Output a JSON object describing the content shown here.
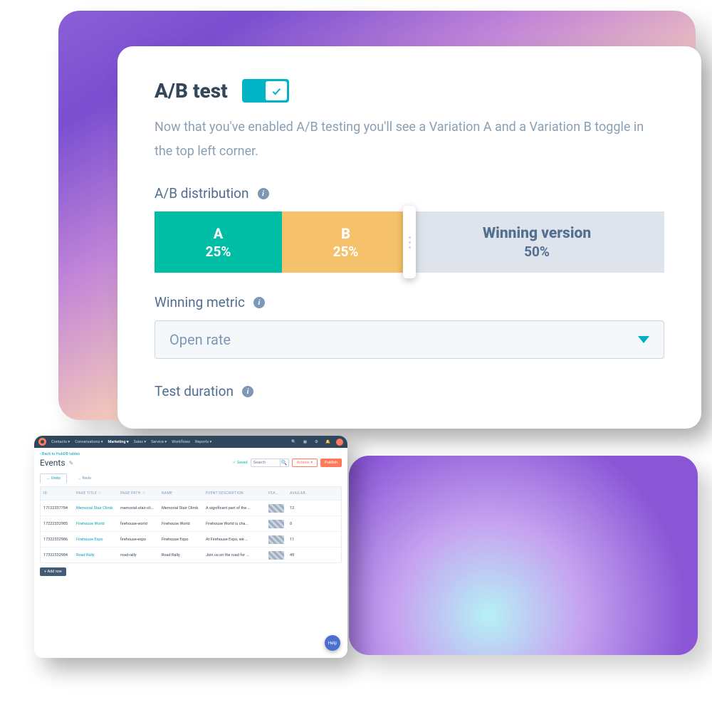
{
  "ab": {
    "title": "A/B test",
    "toggle_on": true,
    "description": "Now that you've enabled A/B testing you'll see a Variation A and a Variation B toggle in the top left corner.",
    "distribution_label": "A/B distribution",
    "segments": {
      "a": {
        "label": "A",
        "pct": "25%"
      },
      "b": {
        "label": "B",
        "pct": "25%"
      },
      "win": {
        "label": "Winning version",
        "pct": "50%"
      }
    },
    "winning_metric_label": "Winning metric",
    "winning_metric_value": "Open rate",
    "test_duration_label": "Test duration"
  },
  "events": {
    "breadcrumb": "‹ Back to HubDB tables",
    "title": "Events",
    "saved": "✓  Saved",
    "search_placeholder": "Search",
    "actions_label": "Actions ▾",
    "publish_label": "Publish",
    "tabs": {
      "undo": "Undo",
      "redo": "Redo"
    },
    "addrow": "+ Add row",
    "help": "Help",
    "topnav": {
      "items": [
        "Contacts ▾",
        "Conversations ▾",
        "Marketing ▾",
        "Sales ▾",
        "Service ▾",
        "Workflows",
        "Reports ▾"
      ],
      "active_index": 2
    },
    "columns": [
      "ID",
      "PAGE TITLE",
      "PAGE PATH",
      "NAME",
      "EVENT DESCRIPTION",
      "FEA...",
      "AVAILAB..."
    ],
    "rows": [
      {
        "id": "17122337784",
        "page_title": "Memorial Stair Climb",
        "page_path": "memorial-stair-cli...",
        "name": "Memorial Stair Climb",
        "desc": "A significant part of the ...",
        "avail": "12"
      },
      {
        "id": "17222332985",
        "page_title": "Firehouse World",
        "page_path": "firehouse-world",
        "name": "Firehouse World",
        "desc": "Firehouse World is cha...",
        "avail": "0"
      },
      {
        "id": "17322332986",
        "page_title": "Firehouse Expo",
        "page_path": "firehouse-expo",
        "name": "Firehouse Expo",
        "desc": "At Firehouse Expo, we ...",
        "avail": "11"
      },
      {
        "id": "17322332984",
        "page_title": "Road Rally",
        "page_path": "road-rally",
        "name": "Road Rally",
        "desc": "Join us on the road for ...",
        "avail": "49"
      }
    ]
  }
}
